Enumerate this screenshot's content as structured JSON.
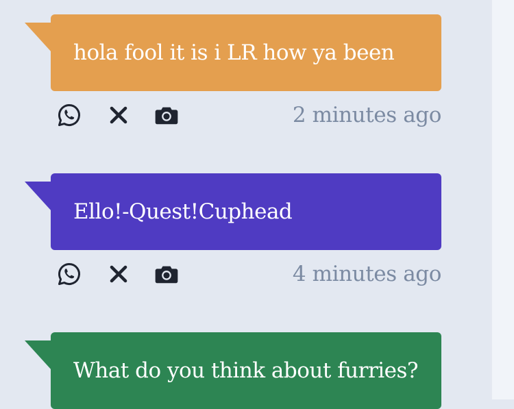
{
  "messages": [
    {
      "text": "hola fool it is i LR how ya been",
      "color": "#e49f4f",
      "timestamp": "2 minutes ago",
      "actions": [
        "whatsapp-icon",
        "close-icon",
        "camera-icon"
      ]
    },
    {
      "text": "Ello!-Quest!Cuphead",
      "color": "#4f3bc2",
      "timestamp": "4 minutes ago",
      "actions": [
        "whatsapp-icon",
        "close-icon",
        "camera-icon"
      ]
    },
    {
      "text": "What do you think about furries?",
      "color": "#2d8553",
      "timestamp": "",
      "actions": []
    }
  ]
}
